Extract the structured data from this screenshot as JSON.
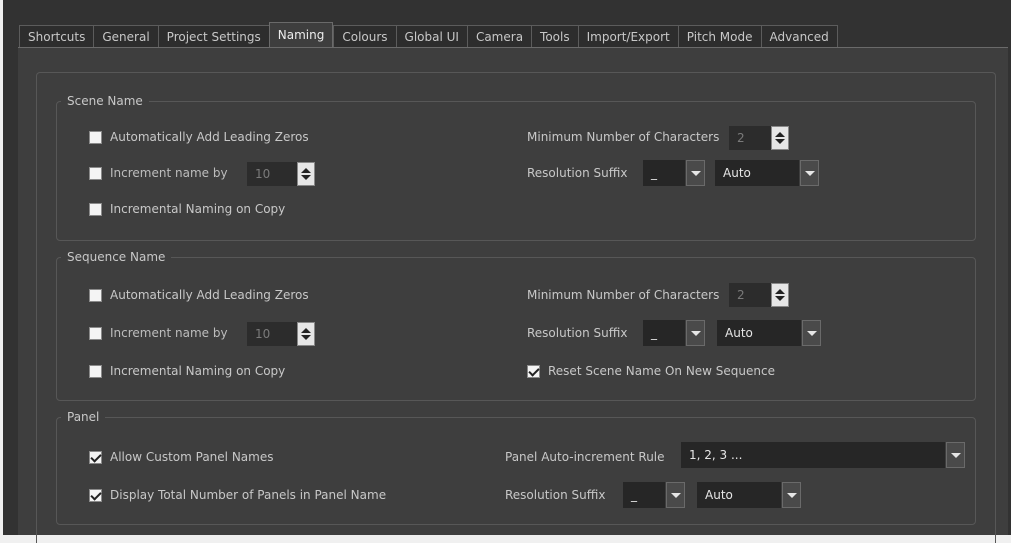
{
  "tabs": [
    {
      "label": "Shortcuts",
      "active": false
    },
    {
      "label": "General",
      "active": false
    },
    {
      "label": "Project Settings",
      "active": false
    },
    {
      "label": "Naming",
      "active": true
    },
    {
      "label": "Colours",
      "active": false
    },
    {
      "label": "Global UI",
      "active": false
    },
    {
      "label": "Camera",
      "active": false
    },
    {
      "label": "Tools",
      "active": false
    },
    {
      "label": "Import/Export",
      "active": false
    },
    {
      "label": "Pitch Mode",
      "active": false
    },
    {
      "label": "Advanced",
      "active": false
    }
  ],
  "scene": {
    "title": "Scene Name",
    "leading_zeros": {
      "label": "Automatically Add Leading Zeros",
      "checked": false
    },
    "increment": {
      "label": "Increment name by",
      "checked": false,
      "value": "10"
    },
    "naming_on_copy": {
      "label": "Incremental Naming on Copy",
      "checked": false
    },
    "min_chars": {
      "label": "Minimum Number of Characters",
      "value": "2"
    },
    "res_suffix": {
      "label": "Resolution Suffix",
      "separator": "_",
      "mode": "Auto"
    }
  },
  "sequence": {
    "title": "Sequence Name",
    "leading_zeros": {
      "label": "Automatically Add Leading Zeros",
      "checked": false
    },
    "increment": {
      "label": "Increment name by",
      "checked": false,
      "value": "10"
    },
    "naming_on_copy": {
      "label": "Incremental Naming on Copy",
      "checked": false
    },
    "min_chars": {
      "label": "Minimum Number of Characters",
      "value": "2"
    },
    "res_suffix": {
      "label": "Resolution Suffix",
      "separator": "_",
      "mode": "Auto"
    },
    "reset_scene": {
      "label": "Reset Scene Name On New Sequence",
      "checked": true
    }
  },
  "panel": {
    "title": "Panel",
    "allow_custom": {
      "label": "Allow Custom Panel Names",
      "checked": true
    },
    "display_total": {
      "label": "Display Total Number of Panels in Panel Name",
      "checked": true
    },
    "auto_increment": {
      "label": "Panel Auto-increment Rule",
      "value": "1, 2, 3 ..."
    },
    "res_suffix": {
      "label": "Resolution Suffix",
      "separator": "_",
      "mode": "Auto"
    }
  }
}
